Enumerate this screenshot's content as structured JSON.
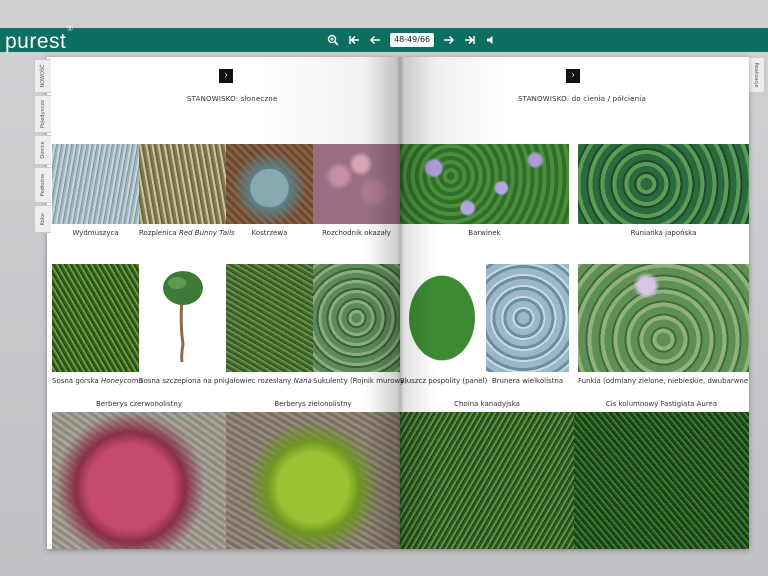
{
  "app": {
    "logo": "purest",
    "logo_mark": "®"
  },
  "toolbar": {
    "zoom_icon": "zoom-in-icon",
    "first_icon": "first-page-icon",
    "prev_icon": "prev-page-icon",
    "page_counter": "48-49/66",
    "next_icon": "next-page-icon",
    "last_icon": "last-page-icon",
    "sound_icon": "sound-icon"
  },
  "side_tabs": [
    "NOWOŚĆ",
    "Pojedyncze",
    "Donice",
    "Podłożne",
    "Kolor"
  ],
  "right_tab": "Realizacje",
  "left_page": {
    "heading": "STANOWISKO: słoneczne",
    "row1": [
      "Wydmuszyca",
      "Rozplenica",
      "Kostrzewa",
      "Rozchodnik okazały"
    ],
    "row1_italic": "Red Bunny Tails",
    "row2": [
      "Sosna górska",
      "Sosna szczepiona na pniu",
      "Jałowiec rozesłany",
      "Sukulenty (Rojnik murowy)"
    ],
    "row2_italic_a": "Honeycomb",
    "row2_italic_b": "Nana",
    "row3": [
      "Berberys czerwonolistny",
      "Berberys zielonolistny"
    ]
  },
  "right_page": {
    "heading": "STANOWISKO: do cienia / półcienia",
    "row1": [
      "Barwinek",
      "Runianka japońska"
    ],
    "row2": [
      "Bluszcz pospolity (panel)",
      "Brunera wielkolistna",
      "Funkia (odmiany zielone, niebieskie, dwubarwne)"
    ],
    "row3": [
      "Choina kanadyjska",
      "Cis kolumnowy Fastigiata Aurea"
    ]
  },
  "colors": {
    "topbar": "#0d6e64",
    "page": "#ffffff",
    "background": "#c8cacc"
  }
}
